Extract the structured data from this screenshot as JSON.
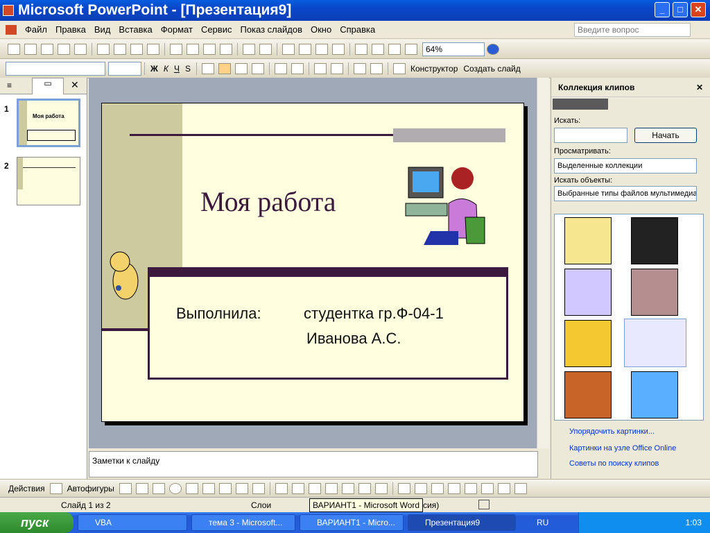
{
  "title": "Microsoft PowerPoint - [Презентация9]",
  "menu": [
    "Файл",
    "Правка",
    "Вид",
    "Вставка",
    "Формат",
    "Сервис",
    "Показ слайдов",
    "Окно",
    "Справка"
  ],
  "ask_placeholder": "Введите вопрос",
  "zoom": "64%",
  "toolbar": {
    "designer": "Конструктор",
    "new_slide": "Создать слайд"
  },
  "slides_panel": {
    "items": [
      "1",
      "2"
    ],
    "thumb1_title": "Моя работа"
  },
  "slide": {
    "title": "Моя работа",
    "line1_label": "Выполнила:",
    "line1_value": "студентка гр.Ф-04-1",
    "line2": "Иванова А.С."
  },
  "notes": "Заметки к слайду",
  "taskpane": {
    "title": "Коллекция клипов",
    "search_label": "Искать:",
    "start_button": "Начать",
    "browse_label": "Просматривать:",
    "browse_value": "Выделенные коллекции",
    "objects_label": "Искать объекты:",
    "objects_value": "Выбранные типы файлов мультимедиа",
    "links": [
      "Упорядочить картинки...",
      "Картинки на узле Office Online",
      "Советы по поиску клипов"
    ]
  },
  "drawbar": {
    "actions": "Действия",
    "autoshapes": "Автофигуры"
  },
  "status": {
    "slide": "Слайд 1 из 2",
    "layout": "Слои",
    "lang_tail": "ссия)"
  },
  "tooltip": "ВАРИАНТ1 - Microsoft Word",
  "taskbar": {
    "start": "пуск",
    "items": [
      "VBA",
      "тема 3 - Microsoft...",
      "ВАРИАНТ1 - Micro...",
      "Презентация9"
    ],
    "lang": "RU",
    "time": "1:03"
  }
}
